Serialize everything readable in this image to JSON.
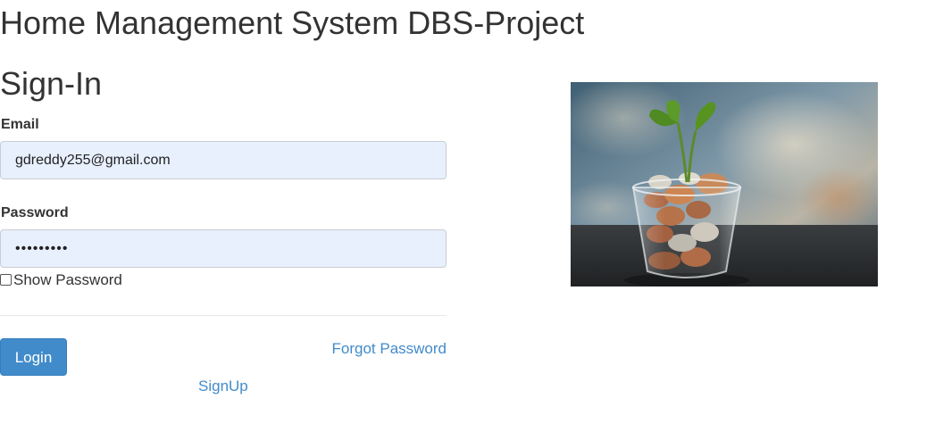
{
  "header": {
    "title": "Home Management System DBS-Project"
  },
  "form": {
    "heading": "Sign-In",
    "email_label": "Email",
    "email_value": "gdreddy255@gmail.com",
    "password_label": "Password",
    "password_value": "•••••••••",
    "show_password_label": "Show Password",
    "show_password_checked": false,
    "login_label": "Login",
    "forgot_label": "Forgot Password",
    "signup_label": "SignUp"
  },
  "colors": {
    "primary": "#428bca",
    "autofill_background": "#e8f0fe",
    "text": "#333333"
  },
  "image": {
    "subject": "glass-of-coins-with-plant-sprout"
  }
}
